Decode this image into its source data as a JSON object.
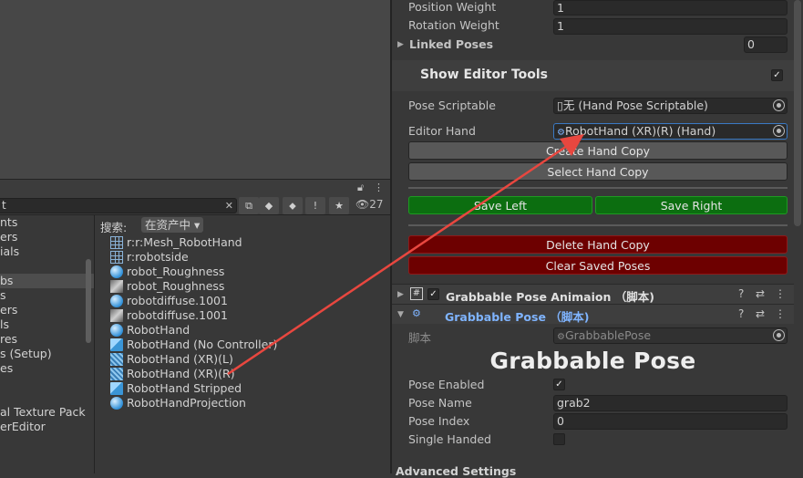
{
  "project": {
    "search_text": "t",
    "result_count": "27",
    "search_label": "搜索:",
    "search_scope": "在资产中",
    "tree_items": [
      "nts",
      "ers",
      "ials",
      "",
      "bs",
      "s",
      "ers",
      "ls",
      "res",
      "s (Setup)",
      "es",
      "",
      "",
      "al Texture Pack",
      "erEditor"
    ],
    "tree_selected_index": 4,
    "assets": [
      {
        "name": "r:r:Mesh_RobotHand",
        "icon": "mesh-icon"
      },
      {
        "name": "r:robotside",
        "icon": "mesh-icon"
      },
      {
        "name": "robot_Roughness",
        "icon": "material-icon"
      },
      {
        "name": "robot_Roughness",
        "icon": "texture-icon"
      },
      {
        "name": "robotdiffuse.1001",
        "icon": "material-icon"
      },
      {
        "name": "robotdiffuse.1001",
        "icon": "texture-icon"
      },
      {
        "name": "RobotHand",
        "icon": "material-icon"
      },
      {
        "name": "RobotHand (No Controller)",
        "icon": "prefab-icon"
      },
      {
        "name": "RobotHand (XR)(L)",
        "icon": "prefab-variant-icon"
      },
      {
        "name": "RobotHand (XR)(R)",
        "icon": "prefab-variant-icon"
      },
      {
        "name": "RobotHand Stripped",
        "icon": "prefab-icon"
      },
      {
        "name": "RobotHandProjection",
        "icon": "material-icon"
      }
    ]
  },
  "inspector": {
    "position_weight": {
      "label": "Position Weight",
      "value": "1"
    },
    "rotation_weight": {
      "label": "Rotation Weight",
      "value": "1"
    },
    "linked_poses": {
      "label": "Linked Poses",
      "value": "0"
    },
    "editor_tools": {
      "label": "Show Editor Tools",
      "checked": true
    },
    "pose_scriptable": {
      "label": "Pose Scriptable",
      "value": "无 (Hand Pose Scriptable)"
    },
    "editor_hand": {
      "label": "Editor Hand",
      "value": "RobotHand (XR)(R) (Hand)"
    },
    "buttons": {
      "create_copy": "Create Hand Copy",
      "select_copy": "Select Hand Copy",
      "save_left": "Save Left",
      "save_right": "Save Right",
      "delete_copy": "Delete Hand Copy",
      "clear_saved": "Clear Saved Poses"
    },
    "component1": {
      "title": "Grabbable Pose Animaion （脚本)",
      "enabled": true
    },
    "component2": {
      "title": "Grabbable Pose （脚本)"
    },
    "script_field": {
      "label": "脚本",
      "value": "GrabbablePose"
    },
    "big_title": "Grabbable Pose",
    "pose_enabled": {
      "label": "Pose Enabled",
      "checked": true
    },
    "pose_name": {
      "label": "Pose Name",
      "value": "grab2"
    },
    "pose_index": {
      "label": "Pose Index",
      "value": "0"
    },
    "single_handed": {
      "label": "Single Handed",
      "checked": false
    },
    "cut_header": "Advanced Settings"
  },
  "colors": {
    "annotation_arrow": "#e8473f",
    "save_green": "#0c6e10",
    "delete_red": "#6d0000",
    "accent_blue": "#7fb4ff"
  }
}
